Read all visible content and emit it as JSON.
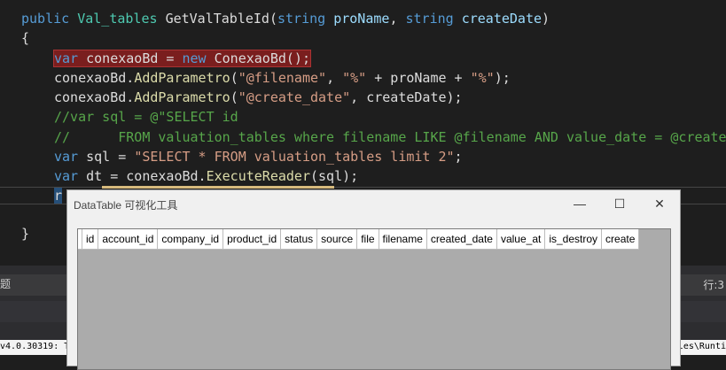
{
  "editor": {
    "line1": {
      "kw": "public",
      "ty": "Val_tables",
      "name": "GetValTableId",
      "paren": "(",
      "t1": "string",
      "p1": "proName",
      "comma": ",",
      "t2": "string",
      "p2": "createDate",
      "close": ")"
    },
    "line2": "{",
    "line3": {
      "kw": "var",
      "a": " conexaoBd = ",
      "new": "new",
      "ty": "ConexaoBd",
      "end": "();"
    },
    "line4": {
      "obj": "conexaoBd.",
      "m": "AddParametro",
      "a": "(",
      "s1": "\"@filename\"",
      "b": ", ",
      "s2": "\"%\"",
      "c": " + proName + ",
      "s3": "\"%\"",
      "end": ");"
    },
    "line5": {
      "obj": "conexaoBd.",
      "m": "AddParametro",
      "a": "(",
      "s1": "\"@create_date\"",
      "end": ", createDate);"
    },
    "line6": "//var sql = @\"SELECT id",
    "line7": "//      FROM valuation_tables where filename LIKE @filename AND value_date = @create",
    "line8": {
      "kw": "var",
      "a": " sql = ",
      "s": "\"SELECT * FROM valuation_tables limit 2\"",
      "end": ";"
    },
    "line9": {
      "kw": "var",
      "a": " dt = conexaoBd.",
      "m": "ExecuteReader",
      "end": "(sql);"
    },
    "line10": "r",
    "line11": "}"
  },
  "status": {
    "left_text": "题",
    "right_text": "行:3"
  },
  "output": {
    "left_text": "v4.0.30319: T",
    "right_text": "les\\Runti"
  },
  "tool_window": {
    "title": "DataTable 可视化工具",
    "minimize": "—",
    "maximize": "☐",
    "close": "✕",
    "columns": [
      "id",
      "account_id",
      "company_id",
      "product_id",
      "status",
      "source",
      "file",
      "filename",
      "created_date",
      "value_at",
      "is_destroy",
      "create"
    ]
  },
  "colors": {
    "editor_bg": "#1e1e1e",
    "keyword": "#569cd6",
    "type": "#4ec9b0",
    "string": "#d69d85",
    "comment": "#57a64a",
    "method": "#dcdcaa",
    "error_highlight": "#7a1e1e",
    "tool_bg": "#f0f0f0",
    "grid_bg": "#ababab"
  }
}
